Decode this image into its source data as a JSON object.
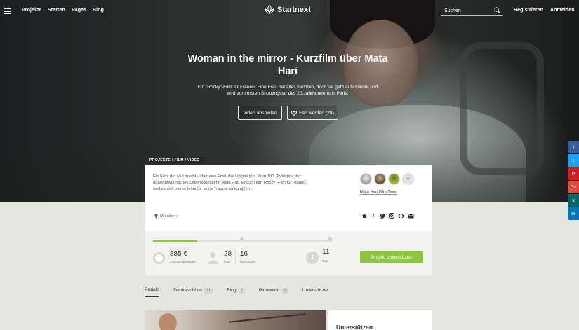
{
  "nav": {
    "links": [
      "Projekte",
      "Starten",
      "Pages",
      "Blog"
    ],
    "logo_text": "Startnext",
    "search_placeholder": "Suchen",
    "register": "Registrieren",
    "login": "Anmelden"
  },
  "hero": {
    "title_line1": "Woman in the mirror - Kurzfilm über Mata",
    "title_line2": "Hari",
    "subtitle_line1": "Ein \"Rocky\"-Film für Frauen! Eine Frau hat alles verloren, doch sie geht aufs Ganze und",
    "subtitle_line2": "wird zum ersten Shootingstar des 20.Jahrhunderts in Paris.",
    "video_button": "Video abspielen",
    "fan_button": "Fan werden (28)"
  },
  "social": [
    "f",
    "t",
    "P",
    "G+",
    "x",
    "in"
  ],
  "project": {
    "category_tag": "PROJEKTE / FILM / VIDEO",
    "description_lines": [
      "Ein Film, der Mut macht - über eine Frau, die Vollgas gibt. Zum 100. Todesjahr der",
      "außergewöhnlichen Lebenskünstlerin Mata Hari. Endlich ein \"Rocky\"-Film für Frauen,",
      "weil es sich immer lohnt für seine Träume zu kämpfen."
    ],
    "team_name": "Mata Hari Film Team",
    "team_more": "+",
    "location": "München",
    "share_icons": [
      "home-icon",
      "facebook-icon",
      "twitter-icon",
      "instagram-icon",
      "embed-icon",
      "mail-icon"
    ],
    "funding_progress": 0.245,
    "funded_amount": "885 €",
    "funding_goal_label": "1.800 € Fundingziel",
    "fans_count": "28",
    "fans_label": "Fans",
    "supporters_count": "16",
    "supporters_label": "Unterstützer",
    "days_count": "11",
    "days_label": "Tage",
    "support_button": "Projekt unterstützen"
  },
  "tabs": [
    {
      "label": "Projekt",
      "badge": ""
    },
    {
      "label": "Dankeschöns",
      "badge": "11"
    },
    {
      "label": "Blog",
      "badge": "2"
    },
    {
      "label": "Pinnwand",
      "badge": "2"
    },
    {
      "label": "Unterstützer",
      "badge": ""
    }
  ],
  "sidebox": {
    "title": "Unterstützen"
  },
  "colors": {
    "accent_green": "#8cc63f",
    "facebook": "#3b5998",
    "twitter": "#1da1f2",
    "pinterest": "#cb2027",
    "googleplus": "#dd4b39",
    "xing": "#026466",
    "linkedin": "#0077b5"
  }
}
